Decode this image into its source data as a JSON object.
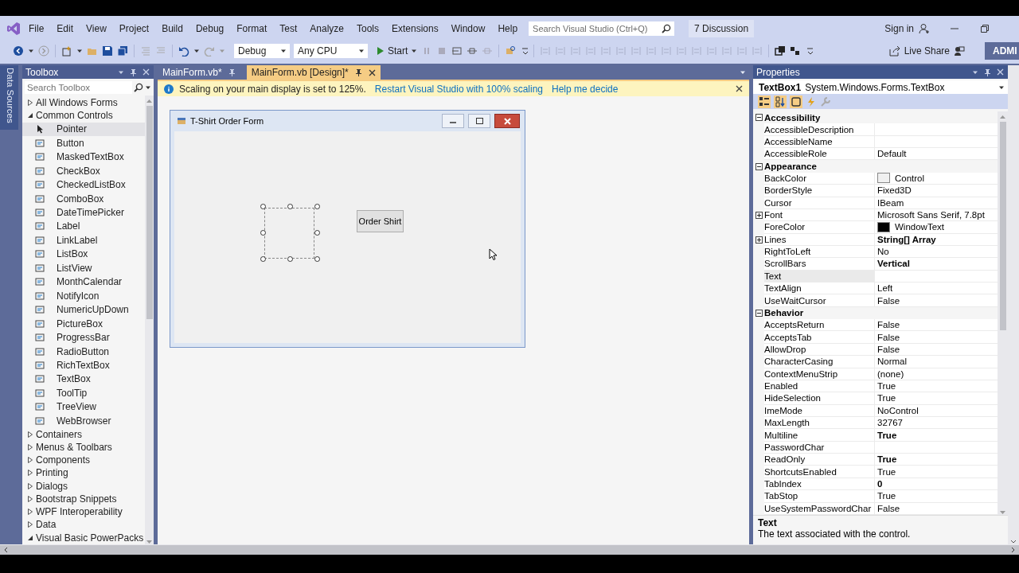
{
  "menu": [
    "File",
    "Edit",
    "View",
    "Project",
    "Build",
    "Debug",
    "Format",
    "Test",
    "Analyze",
    "Tools",
    "Extensions",
    "Window",
    "Help"
  ],
  "search": {
    "placeholder": "Search Visual Studio (Ctrl+Q)"
  },
  "discussion": "7 Discussion",
  "sign_in": "Sign in",
  "toolbar": {
    "configuration": "Debug",
    "platform": "Any CPU",
    "start": "Start",
    "live_share": "Live Share",
    "account": "ADMI"
  },
  "side_tab": "Data Sources",
  "toolbox": {
    "title": "Toolbox",
    "search": {
      "placeholder": "Search Toolbox"
    },
    "groups": [
      {
        "label": "All Windows Forms",
        "expanded": false
      },
      {
        "label": "Common Controls",
        "expanded": true,
        "children": [
          {
            "label": "Pointer",
            "kind": "pointer",
            "selected": true
          },
          {
            "label": "Button",
            "kind": "control",
            "selected": false
          },
          {
            "label": "MaskedTextBox",
            "kind": "control",
            "selected": false
          },
          {
            "label": "CheckBox",
            "kind": "control",
            "selected": false
          },
          {
            "label": "CheckedListBox",
            "kind": "control",
            "selected": false
          },
          {
            "label": "ComboBox",
            "kind": "control",
            "selected": false
          },
          {
            "label": "DateTimePicker",
            "kind": "control",
            "selected": false
          },
          {
            "label": "Label",
            "kind": "control",
            "selected": false
          },
          {
            "label": "LinkLabel",
            "kind": "control",
            "selected": false
          },
          {
            "label": "ListBox",
            "kind": "control",
            "selected": false
          },
          {
            "label": "ListView",
            "kind": "control",
            "selected": false
          },
          {
            "label": "MonthCalendar",
            "kind": "control",
            "selected": false
          },
          {
            "label": "NotifyIcon",
            "kind": "control",
            "selected": false
          },
          {
            "label": "NumericUpDown",
            "kind": "control",
            "selected": false
          },
          {
            "label": "PictureBox",
            "kind": "control",
            "selected": false
          },
          {
            "label": "ProgressBar",
            "kind": "control",
            "selected": false
          },
          {
            "label": "RadioButton",
            "kind": "control",
            "selected": false
          },
          {
            "label": "RichTextBox",
            "kind": "control",
            "selected": false
          },
          {
            "label": "TextBox",
            "kind": "control",
            "selected": false
          },
          {
            "label": "ToolTip",
            "kind": "control",
            "selected": false
          },
          {
            "label": "TreeView",
            "kind": "control",
            "selected": false
          },
          {
            "label": "WebBrowser",
            "kind": "control",
            "selected": false
          }
        ]
      },
      {
        "label": "Containers",
        "expanded": false
      },
      {
        "label": "Menus & Toolbars",
        "expanded": false
      },
      {
        "label": "Components",
        "expanded": false
      },
      {
        "label": "Printing",
        "expanded": false
      },
      {
        "label": "Dialogs",
        "expanded": false
      },
      {
        "label": "Bootstrap Snippets",
        "expanded": false
      },
      {
        "label": "WPF Interoperability",
        "expanded": false
      },
      {
        "label": "Data",
        "expanded": false
      },
      {
        "label": "Visual Basic PowerPacks",
        "expanded": true
      }
    ]
  },
  "tabs": [
    {
      "label": "MainForm.vb*",
      "selected": false
    },
    {
      "label": "MainForm.vb [Design]*",
      "selected": true
    }
  ],
  "infobar": {
    "message": "Scaling on your main display is set to 125%.",
    "links": [
      "Restart Visual Studio with 100% scaling",
      "Help me decide"
    ]
  },
  "form": {
    "title": "T-Shirt Order Form",
    "button": "Order Shirt"
  },
  "properties": {
    "title": "Properties",
    "object": "TextBox1",
    "type": "System.Windows.Forms.TextBox",
    "rows": [
      {
        "kind": "category",
        "label": "Accessibility",
        "expanded": true
      },
      {
        "kind": "property",
        "name": "AccessibleDescription",
        "selected": false
      },
      {
        "kind": "property",
        "name": "AccessibleName",
        "selected": false
      },
      {
        "kind": "property",
        "name": "AccessibleRole",
        "value": "Default",
        "selected": false
      },
      {
        "kind": "category",
        "label": "Appearance",
        "expanded": true
      },
      {
        "kind": "property",
        "name": "BackColor",
        "value": "Control",
        "color": "#f0f0f0",
        "selected": false
      },
      {
        "kind": "property",
        "name": "BorderStyle",
        "value": "Fixed3D",
        "selected": false
      },
      {
        "kind": "property",
        "name": "Cursor",
        "value": "IBeam",
        "selected": false
      },
      {
        "kind": "property",
        "name": "Font",
        "value": "Microsoft Sans Serif, 7.8pt",
        "expanded": false,
        "selected": false
      },
      {
        "kind": "property",
        "name": "ForeColor",
        "value": "WindowText",
        "color": "#000000",
        "selected": false
      },
      {
        "kind": "property",
        "name": "Lines",
        "value": "String[] Array",
        "modified": true,
        "expanded": false,
        "selected": false
      },
      {
        "kind": "property",
        "name": "RightToLeft",
        "value": "No",
        "selected": false
      },
      {
        "kind": "property",
        "name": "ScrollBars",
        "value": "Vertical",
        "modified": true,
        "selected": false
      },
      {
        "kind": "property",
        "name": "Text",
        "selected": true
      },
      {
        "kind": "property",
        "name": "TextAlign",
        "value": "Left",
        "selected": false
      },
      {
        "kind": "property",
        "name": "UseWaitCursor",
        "value": "False",
        "selected": false
      },
      {
        "kind": "category",
        "label": "Behavior",
        "expanded": true
      },
      {
        "kind": "property",
        "name": "AcceptsReturn",
        "value": "False",
        "selected": false
      },
      {
        "kind": "property",
        "name": "AcceptsTab",
        "value": "False",
        "selected": false
      },
      {
        "kind": "property",
        "name": "AllowDrop",
        "value": "False",
        "selected": false
      },
      {
        "kind": "property",
        "name": "CharacterCasing",
        "value": "Normal",
        "selected": false
      },
      {
        "kind": "property",
        "name": "ContextMenuStrip",
        "value": "(none)",
        "selected": false
      },
      {
        "kind": "property",
        "name": "Enabled",
        "value": "True",
        "selected": false
      },
      {
        "kind": "property",
        "name": "HideSelection",
        "value": "True",
        "selected": false
      },
      {
        "kind": "property",
        "name": "ImeMode",
        "value": "NoControl",
        "selected": false
      },
      {
        "kind": "property",
        "name": "MaxLength",
        "value": "32767",
        "selected": false
      },
      {
        "kind": "property",
        "name": "Multiline",
        "value": "True",
        "modified": true,
        "selected": false
      },
      {
        "kind": "property",
        "name": "PasswordChar",
        "selected": false
      },
      {
        "kind": "property",
        "name": "ReadOnly",
        "value": "True",
        "modified": true,
        "selected": false
      },
      {
        "kind": "property",
        "name": "ShortcutsEnabled",
        "value": "True",
        "selected": false
      },
      {
        "kind": "property",
        "name": "TabIndex",
        "value": "0",
        "modified": true,
        "selected": false
      },
      {
        "kind": "property",
        "name": "TabStop",
        "value": "True",
        "selected": false
      },
      {
        "kind": "property",
        "name": "UseSystemPasswordChar",
        "value": "False",
        "selected": false
      }
    ],
    "description": {
      "title": "Text",
      "text": "The text associated with the control."
    }
  }
}
